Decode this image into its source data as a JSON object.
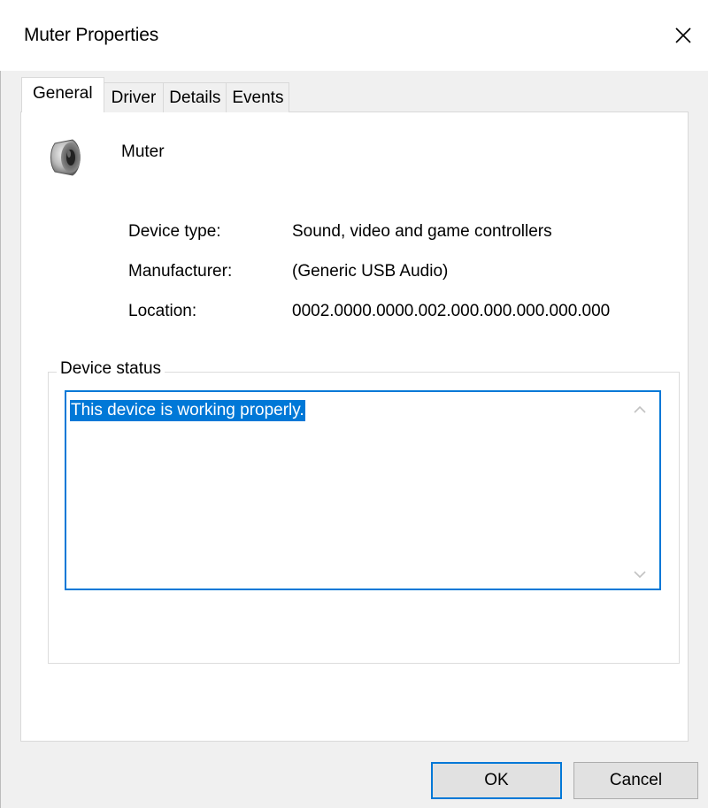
{
  "window": {
    "title": "Muter Properties",
    "close_icon": "close-icon"
  },
  "tabs": [
    {
      "label": "General",
      "active": true
    },
    {
      "label": "Driver",
      "active": false
    },
    {
      "label": "Details",
      "active": false
    },
    {
      "label": "Events",
      "active": false
    }
  ],
  "device": {
    "icon": "speaker-icon",
    "name": "Muter"
  },
  "properties": [
    {
      "label": "Device type:",
      "value": "Sound, video and game controllers"
    },
    {
      "label": "Manufacturer:",
      "value": "(Generic USB Audio)"
    },
    {
      "label": "Location:",
      "value": "0002.0000.0000.002.000.000.000.000.000"
    }
  ],
  "status": {
    "group_label": "Device status",
    "text": "This device is working properly."
  },
  "buttons": {
    "ok": "OK",
    "cancel": "Cancel"
  },
  "colors": {
    "accent": "#0078d7",
    "window_bg": "#f0f0f0",
    "panel_bg": "#ffffff"
  }
}
